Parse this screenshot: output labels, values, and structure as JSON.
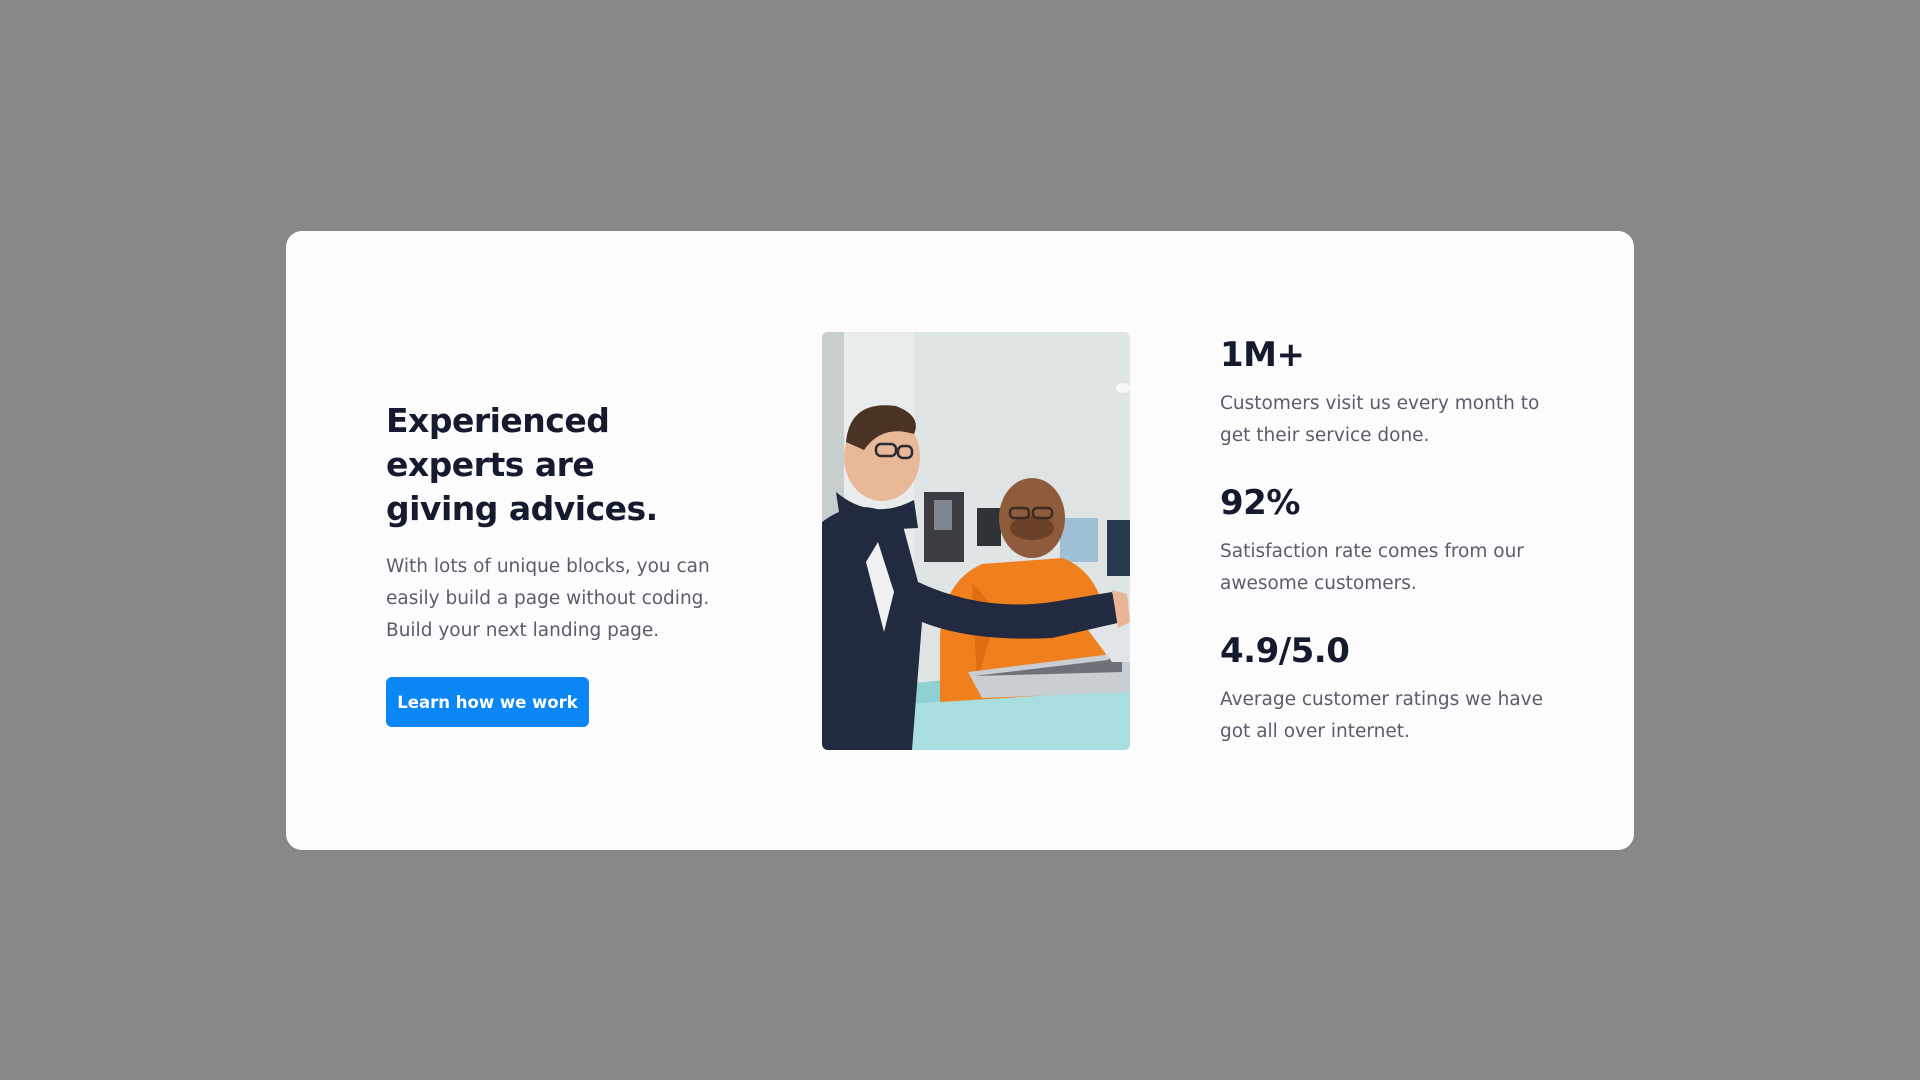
{
  "hero": {
    "headline": "Experienced experts are giving advices.",
    "description": "With lots of unique blocks, you can easily build a page without coding. Build your next landing page.",
    "cta_label": "Learn how we work",
    "cta_color": "#0a87f5"
  },
  "image": {
    "alt": "Two men looking at a laptop in an office"
  },
  "stats": [
    {
      "value": "1M+",
      "description": "Customers visit us every month to get their service done."
    },
    {
      "value": "92%",
      "description": "Satisfaction rate comes from our awesome customers."
    },
    {
      "value": "4.9/5.0",
      "description": "Average customer ratings we have got all over internet."
    }
  ],
  "colors": {
    "backdrop": "#888888",
    "card": "#fcfcfc",
    "heading": "#151b2e",
    "body_text": "#5a5d6b"
  }
}
